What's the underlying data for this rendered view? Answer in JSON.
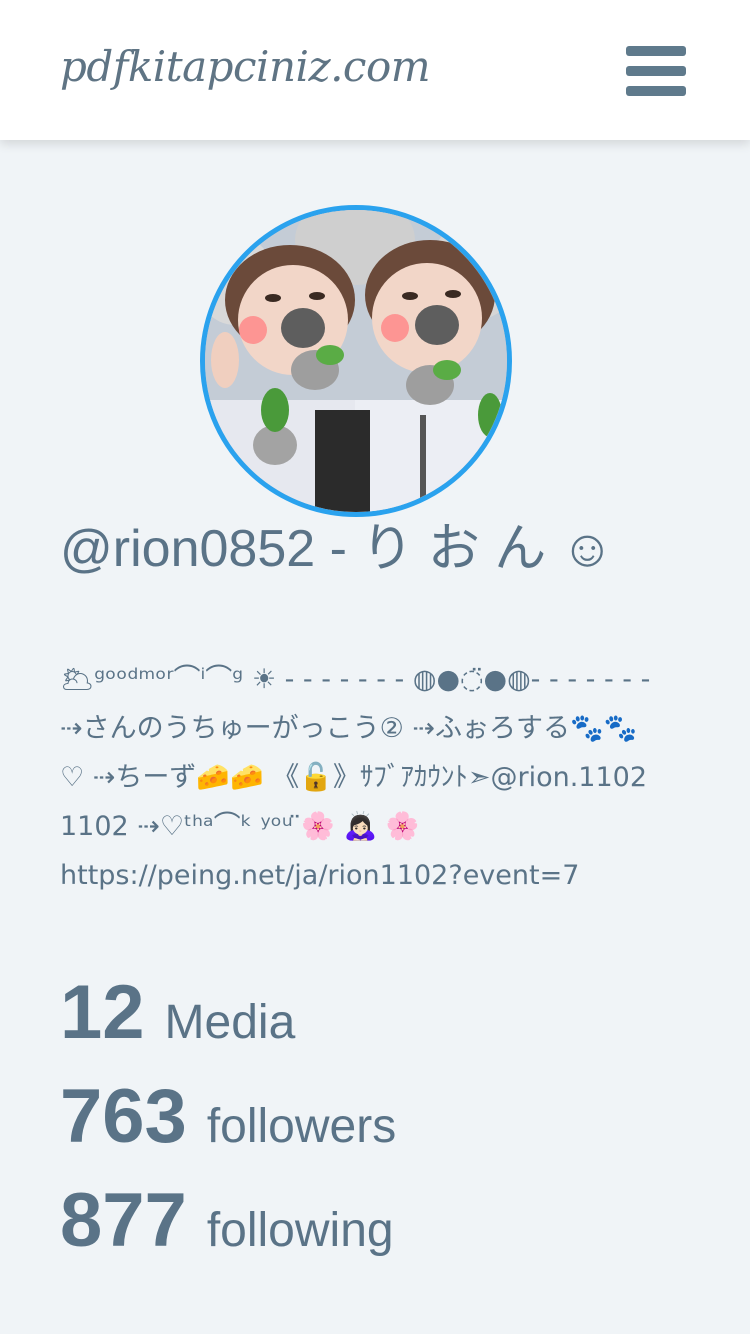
{
  "header": {
    "logo_text": "pdfkitapciniz.com",
    "menu_icon": "hamburger-menu-icon"
  },
  "profile": {
    "avatar_alt": "profile photo",
    "title": "@rion0852 - り お ん ☺",
    "bio": "🌥ᵍᵒᵒᵈᵐᵒʳ⌒ⁱ⌒ᵍ ☀︎ ‐ ‐ ‐ ‐ ‐ ‐ ‐ ◍●◌̈●◍‐ ‐ ‐ ‐ ‐ ‐ ‐ ⇢さんのうちゅーがっこう② ⇢ふぉろする🐾🐾♡ ⇢ちーず🧀🧀 《🔓》ｻﾌﾞｱｶｳﾝﾄ➣@rion.11021102 ⇢♡ᵗʰᵃ⌒ᵏ ʸᵒᵘ ̈🌸 🙇🏻‍♀️ 🌸",
    "link": "https://peing.net/ja/rion1102?event=7"
  },
  "stats": [
    {
      "value": "12",
      "label": "Media"
    },
    {
      "value": "763",
      "label": "followers"
    },
    {
      "value": "877",
      "label": "following"
    }
  ],
  "colors": {
    "background": "#f0f4f7",
    "text": "#5a7387",
    "avatar_ring": "#2aa2ee",
    "header_bg": "#ffffff"
  }
}
